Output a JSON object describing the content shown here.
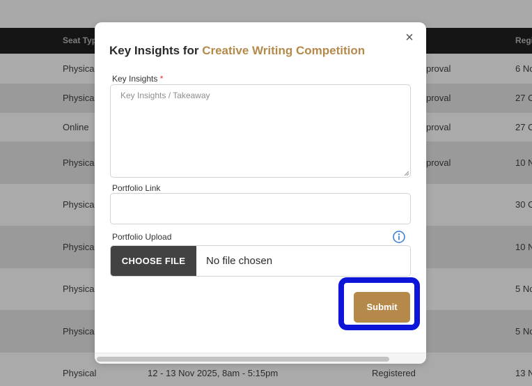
{
  "table": {
    "headers": {
      "seat_type": "Seat Typ",
      "status": "",
      "registered": "Regi"
    },
    "rows": [
      {
        "seat": "Physica",
        "status": "proval",
        "reg": "6 No"
      },
      {
        "seat": "Physica",
        "status": "proval",
        "reg": "27 O"
      },
      {
        "seat": "Online",
        "status": "proval",
        "reg": "27 O"
      },
      {
        "seat": "Physica",
        "status": "proval",
        "reg": "10 N"
      },
      {
        "seat": "Physica",
        "status": "",
        "reg": "30 O"
      },
      {
        "seat": "Physica",
        "status": "",
        "reg": "10 N"
      },
      {
        "seat": "Physica",
        "status": "",
        "reg": "5 No"
      },
      {
        "seat": "Physica",
        "status": "",
        "reg": "5 No"
      },
      {
        "seat": "Physical",
        "date": "12 - 13 Nov 2025, 8am - 5:15pm",
        "status": "Registered",
        "reg": "13 N"
      }
    ]
  },
  "modal": {
    "close_glyph": "×",
    "title_prefix": "Key Insights for ",
    "title_event": "Creative Writing Competition",
    "key_insights_label": "Key Insights",
    "required_mark": "*",
    "key_insights_placeholder": "Key Insights / Takeaway",
    "portfolio_link_label": "Portfolio Link",
    "portfolio_link_value": "",
    "portfolio_upload_label": "Portfolio Upload",
    "choose_file_label": "CHOOSE FILE",
    "no_file_text": "No file chosen",
    "submit_label": "Submit",
    "info_icon": "info-circle-icon"
  },
  "colors": {
    "accent": "#b5894a",
    "focus_ring": "#0d16d8",
    "header_bg": "#151515",
    "info_icon": "#2f7bd6"
  }
}
